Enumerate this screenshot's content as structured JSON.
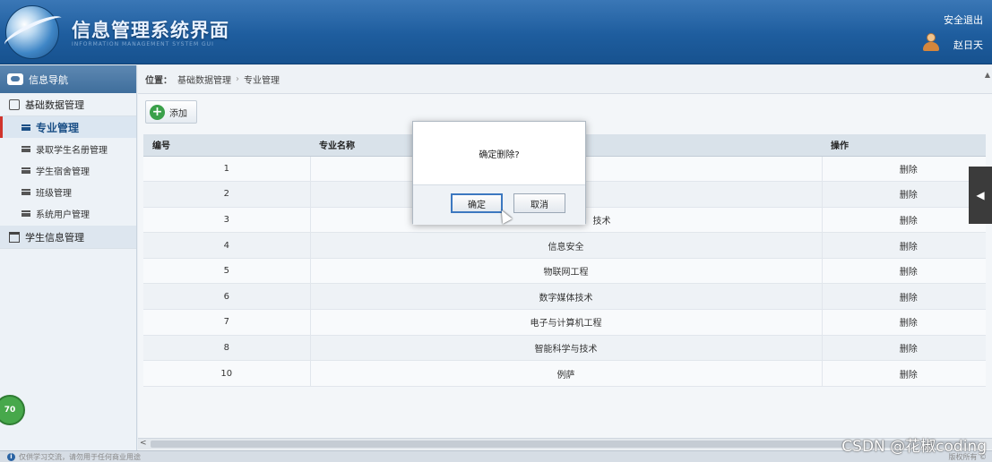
{
  "header": {
    "app_title": "信息管理系统界面",
    "app_subtitle": "INFORMATION MANAGEMENT SYSTEM GUI",
    "logout_label": "安全退出",
    "username": "赵日天"
  },
  "sidebar": {
    "nav_title": "信息导航",
    "group_basic": "基础数据管理",
    "items": [
      {
        "label": "专业管理",
        "active": true
      },
      {
        "label": "录取学生名册管理",
        "active": false
      },
      {
        "label": "学生宿舍管理",
        "active": false
      },
      {
        "label": "班级管理",
        "active": false
      },
      {
        "label": "系统用户管理",
        "active": false
      }
    ],
    "group_student": "学生信息管理",
    "badge": "70"
  },
  "breadcrumb": {
    "location_label": "位置：",
    "level1": "基础数据管理",
    "separator": "›",
    "level2": "专业管理"
  },
  "toolbar": {
    "add_label": "添加"
  },
  "table": {
    "headers": [
      "编号",
      "专业名称",
      "操作"
    ],
    "rows": [
      {
        "id": "1",
        "name": "",
        "action": "删除"
      },
      {
        "id": "2",
        "name": "",
        "action": "删除"
      },
      {
        "id": "3",
        "name": "技术",
        "action": "删除"
      },
      {
        "id": "4",
        "name": "信息安全",
        "action": "删除"
      },
      {
        "id": "5",
        "name": "物联网工程",
        "action": "删除"
      },
      {
        "id": "6",
        "name": "数字媒体技术",
        "action": "删除"
      },
      {
        "id": "7",
        "name": "电子与计算机工程",
        "action": "删除"
      },
      {
        "id": "8",
        "name": "智能科学与技术",
        "action": "删除"
      },
      {
        "id": "10",
        "name": "例萨",
        "action": "删除"
      }
    ]
  },
  "modal": {
    "message": "确定删除?",
    "confirm_label": "确定",
    "cancel_label": "取消"
  },
  "statusbar": {
    "notice": "仅供学习交流，请勿用于任何商业用途",
    "copyright": "版权所有 ©"
  },
  "watermark": "CSDN @花椒coding",
  "colors": {
    "header_bg": "#1e5d9e",
    "active_marker": "#d0342c",
    "add_icon": "#3aa04a"
  }
}
